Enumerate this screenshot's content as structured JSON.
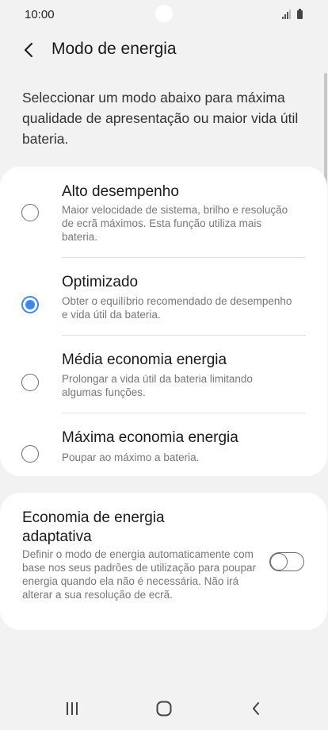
{
  "status_bar": {
    "time": "10:00",
    "signal_icon": "signal-icon",
    "battery_icon": "battery-icon"
  },
  "header": {
    "back_icon": "chevron-left-icon",
    "title": "Modo de energia"
  },
  "description": "Seleccionar um modo abaixo para máxima qualidade de apresentação ou maior vida útil bateria.",
  "modes": [
    {
      "title": "Alto desempenho",
      "description": "Maior velocidade de sistema, brilho e resolução de ecrã máximos. Esta função utiliza mais bateria.",
      "selected": false
    },
    {
      "title": "Optimizado",
      "description": "Obter o equilíbrio recomendado de desempenho e vida útil da bateria.",
      "selected": true
    },
    {
      "title": "Média economia energia",
      "description": "Prolongar a vida útil da bateria limitando algumas funções.",
      "selected": false
    },
    {
      "title": "Máxima economia energia",
      "description": "Poupar ao máximo a bateria.",
      "selected": false
    }
  ],
  "adaptive": {
    "title": "Economia de energia adaptativa",
    "description": "Definir o modo de energia automaticamente com base nos seus padrões de utilização para poupar energia quando ela não é necessária. Não irá alterar a sua resolução de ecrã.",
    "enabled": false
  },
  "nav_bar": {
    "recents_icon": "recents-icon",
    "home_icon": "home-icon",
    "back_icon": "back-icon"
  },
  "colors": {
    "accent": "#3e87f0",
    "background": "#f2f2f2",
    "card": "#ffffff"
  }
}
